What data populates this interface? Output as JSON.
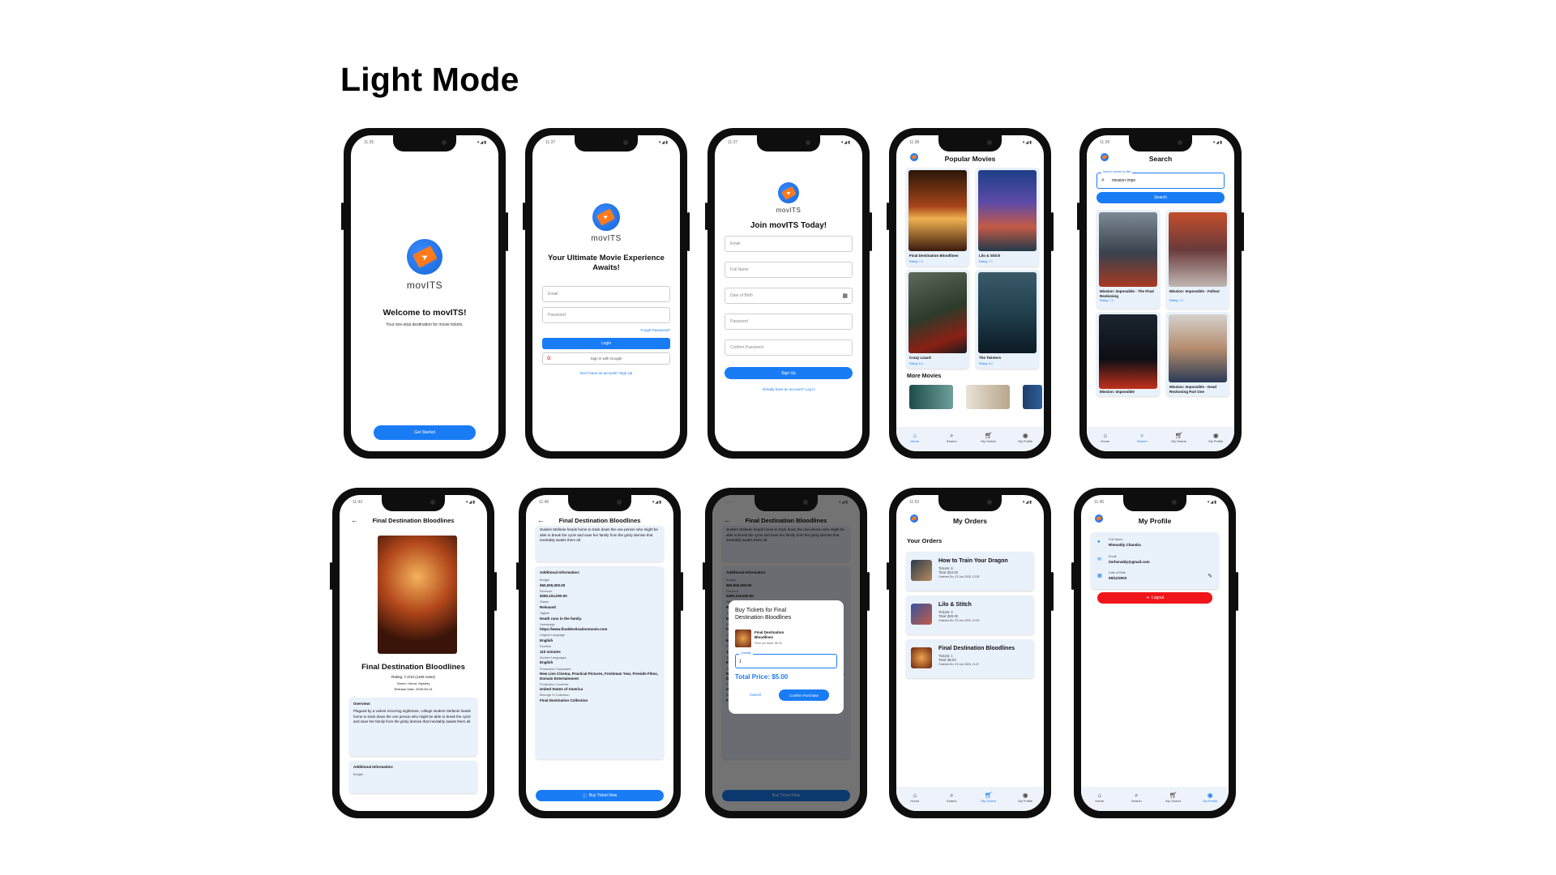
{
  "heading": "Light Mode",
  "app": {
    "brand": "movITS",
    "accent": "#1a7cf5",
    "danger": "#f0151a"
  },
  "status": {
    "t1": "11:35",
    "t2": "11:37",
    "t3": "11:37",
    "t4": "11:38",
    "t5": "11:39",
    "t6": "11:42",
    "t7": "11:46",
    "t8": "11:47",
    "t9": "11:52",
    "t10": "11:46"
  },
  "welcome": {
    "title": "Welcome to movITS!",
    "subtitle": "Your one-stop destination for movie tickets.",
    "button": "Get Started"
  },
  "login": {
    "title": "Your Ultimate Movie Experience Awaits!",
    "email": "Email",
    "password": "Password",
    "forgot": "Forgot Password?",
    "login": "Login",
    "google": "Sign in with Google",
    "signup": "Don't have an account? Sign Up"
  },
  "register": {
    "title": "Join movITS Today!",
    "email": "Email",
    "fullname": "Full Name",
    "dob": "Date of Birth",
    "password": "Password",
    "confirm": "Confirm Password",
    "button": "Sign Up",
    "login": "Already have an account? Log in"
  },
  "nav": {
    "home": "Home",
    "search": "Search",
    "orders": "My Orders",
    "profile": "My Profile"
  },
  "home": {
    "title": "Popular Movies",
    "more": "More Movies",
    "movies": [
      {
        "title": "Final Destination Bloodlines",
        "rating": "Rating: 7.2"
      },
      {
        "title": "Lilo & Stitch",
        "rating": "Rating: 7.1"
      },
      {
        "title": "Crazy Lizard",
        "rating": "Rating: 6.4"
      },
      {
        "title": "The Twisters",
        "rating": "Rating: 5.2"
      }
    ]
  },
  "search": {
    "title": "Search",
    "label": "Search movies by title",
    "value": "mission impo",
    "button": "Search",
    "results": [
      {
        "title": "Mission: Impossible - The Final Reckoning",
        "rating": "Rating: 7.2"
      },
      {
        "title": "Mission: Impossible - Fallout",
        "rating": "Rating: 7.4"
      },
      {
        "title": "Mission: Impossible",
        "rating": ""
      },
      {
        "title": "Mission: Impossible - Dead Reckoning Part One",
        "rating": ""
      }
    ]
  },
  "detail": {
    "title": "Final Destination Bloodlines",
    "movie_title": "Final Destination Bloodlines",
    "rating": "Rating: 7.2/10 (1159 votes)",
    "genre": "Genre: Horror, Mystery",
    "release": "Release Date: 2025-05-14",
    "overview_label": "Overview:",
    "overview": "Plagued by a violent recurring nightmare, college student Stefanie heads home to track down the one person who might be able to break the cycle and save her family from the grisly demise that inevitably awaits them all.",
    "overview_tail": "student Stefanie heads home to track down the one person who might be able to break the cycle and save her family from the grisly demise that inevitably awaits them all.",
    "additional": "Additional Information:",
    "budget_cut": "Budget",
    "buy": "Buy Ticket Now",
    "info": [
      {
        "k": "Budget",
        "v": "$50,000,000.00"
      },
      {
        "k": "Revenue",
        "v": "$280,104,000.00"
      },
      {
        "k": "Status",
        "v": "Released"
      },
      {
        "k": "Tagline",
        "v": "Death runs in the family."
      },
      {
        "k": "Homepage",
        "v": "https://www.finaldestinationmovie.com"
      },
      {
        "k": "Original Language",
        "v": "English"
      },
      {
        "k": "Runtime",
        "v": "110 minutes"
      },
      {
        "k": "Spoken Languages",
        "v": "English"
      },
      {
        "k": "Production Companies",
        "v": "New Line Cinema, Practical Pictures, Freshman Year, Fireside Films, Domain Entertainment"
      },
      {
        "k": "Production Countries",
        "v": "United States of America"
      },
      {
        "k": "Belongs To Collection",
        "v": "Final Destination Collection"
      }
    ]
  },
  "dialog": {
    "title": "Buy Tickets for Final Destination Bloodlines",
    "movie": "Final Destination Bloodlines",
    "price": "Price per ticket: $5.00",
    "qty_label": "Quantity",
    "qty": "1",
    "total": "Total Price: $5.00",
    "cancel": "Cancel",
    "confirm": "Confirm Purchase"
  },
  "orders": {
    "title": "My Orders",
    "section": "Your Orders",
    "items": [
      {
        "title": "How to Train Your Dragon",
        "tickets": "Tickets: 6",
        "total": "Total: $24.00",
        "date": "Ordered On: 23 Jun 2025, 12:35"
      },
      {
        "title": "Lilo & Stitch",
        "tickets": "Tickets: 4",
        "total": "Total: $20.00",
        "date": "Ordered On: 23 Jun 2025, 12:33"
      },
      {
        "title": "Final Destination Bloodlines",
        "tickets": "Tickets: 1",
        "total": "Total: $5.00",
        "date": "Ordered On: 23 Jun 2025, 11:47"
      }
    ]
  },
  "profile": {
    "title": "My Profile",
    "name_label": "Full Name",
    "name": "Rhenaldy Chandra",
    "email_label": "Email",
    "email": "itsrhenaldy@gmail.com",
    "dob_label": "Date of Birth",
    "dob": "05/11/2003",
    "logout": "Logout"
  }
}
